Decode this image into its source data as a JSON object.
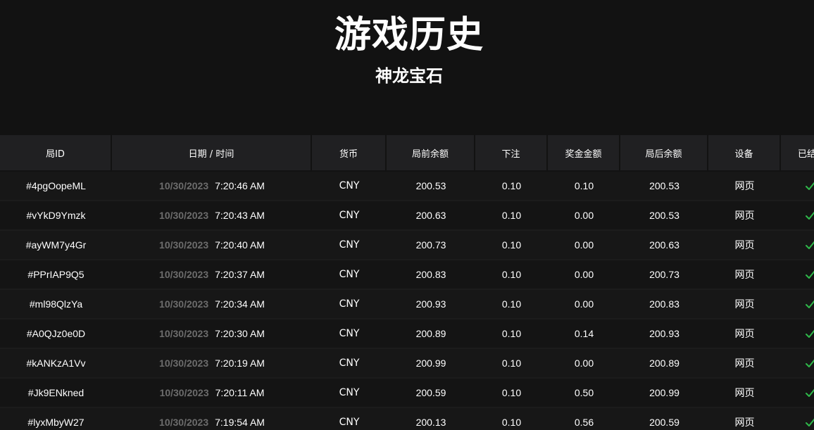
{
  "header": {
    "title": "游戏历史",
    "subtitle": "神龙宝石"
  },
  "table": {
    "columns": [
      "局ID",
      "日期 / 时间",
      "货币",
      "局前余额",
      "下注",
      "奖金金额",
      "局后余额",
      "设备",
      "已结"
    ],
    "rows": [
      {
        "id": "#4pgOopeML",
        "date": "10/30/2023",
        "time": "7:20:46 AM",
        "currency": "CNY",
        "before": "200.53",
        "bet": "0.10",
        "win": "0.10",
        "after": "200.53",
        "device": "网页",
        "settled_icon": "check-icon"
      },
      {
        "id": "#vYkD9Ymzk",
        "date": "10/30/2023",
        "time": "7:20:43 AM",
        "currency": "CNY",
        "before": "200.63",
        "bet": "0.10",
        "win": "0.00",
        "after": "200.53",
        "device": "网页",
        "settled_icon": "check-icon"
      },
      {
        "id": "#ayWM7y4Gr",
        "date": "10/30/2023",
        "time": "7:20:40 AM",
        "currency": "CNY",
        "before": "200.73",
        "bet": "0.10",
        "win": "0.00",
        "after": "200.63",
        "device": "网页",
        "settled_icon": "check-icon"
      },
      {
        "id": "#PPrIAP9Q5",
        "date": "10/30/2023",
        "time": "7:20:37 AM",
        "currency": "CNY",
        "before": "200.83",
        "bet": "0.10",
        "win": "0.00",
        "after": "200.73",
        "device": "网页",
        "settled_icon": "check-icon"
      },
      {
        "id": "#ml98QlzYa",
        "date": "10/30/2023",
        "time": "7:20:34 AM",
        "currency": "CNY",
        "before": "200.93",
        "bet": "0.10",
        "win": "0.00",
        "after": "200.83",
        "device": "网页",
        "settled_icon": "check-icon"
      },
      {
        "id": "#A0QJz0e0D",
        "date": "10/30/2023",
        "time": "7:20:30 AM",
        "currency": "CNY",
        "before": "200.89",
        "bet": "0.10",
        "win": "0.14",
        "after": "200.93",
        "device": "网页",
        "settled_icon": "check-icon"
      },
      {
        "id": "#kANKzA1Vv",
        "date": "10/30/2023",
        "time": "7:20:19 AM",
        "currency": "CNY",
        "before": "200.99",
        "bet": "0.10",
        "win": "0.00",
        "after": "200.89",
        "device": "网页",
        "settled_icon": "check-icon"
      },
      {
        "id": "#Jk9ENkned",
        "date": "10/30/2023",
        "time": "7:20:11 AM",
        "currency": "CNY",
        "before": "200.59",
        "bet": "0.10",
        "win": "0.50",
        "after": "200.99",
        "device": "网页",
        "settled_icon": "check-icon"
      },
      {
        "id": "#lyxMbyW27",
        "date": "10/30/2023",
        "time": "7:19:54 AM",
        "currency": "CNY",
        "before": "200.13",
        "bet": "0.10",
        "win": "0.56",
        "after": "200.59",
        "device": "网页",
        "settled_icon": "check-icon"
      }
    ]
  },
  "colors": {
    "background": "#121212",
    "header_cell": "#202022",
    "date_text": "#6c6c6c",
    "check": "#2fb84a"
  }
}
